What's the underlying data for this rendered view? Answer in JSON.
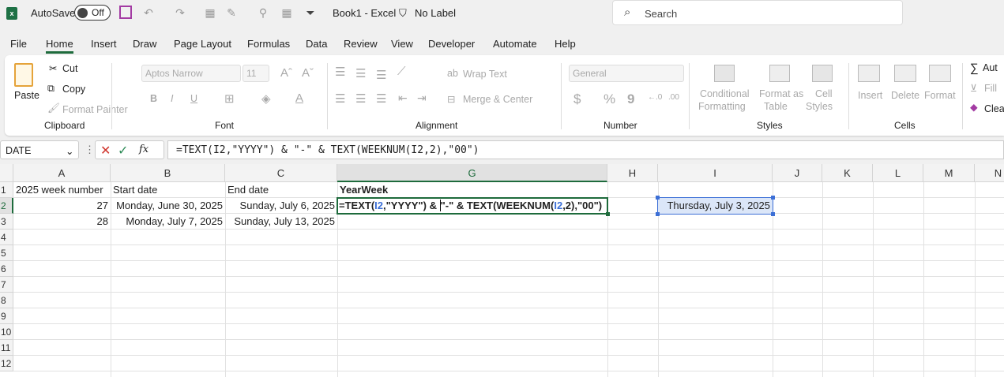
{
  "titlebar": {
    "autosave_label": "AutoSave",
    "autosave_state": "Off",
    "title": "Book1  -  Excel",
    "label": "No Label",
    "search_placeholder": "Search"
  },
  "menu": [
    "File",
    "Home",
    "Insert",
    "Draw",
    "Page Layout",
    "Formulas",
    "Data",
    "Review",
    "View",
    "Developer",
    "Automate",
    "Help"
  ],
  "ribbon": {
    "clipboard": {
      "paste": "Paste",
      "cut": "Cut",
      "copy": "Copy",
      "format_painter": "Format Painter",
      "group": "Clipboard"
    },
    "font": {
      "font_name": "Aptos Narrow",
      "font_size": "11",
      "bold": "B",
      "italic": "I",
      "underline": "U",
      "group": "Font"
    },
    "alignment": {
      "wrap_text": "Wrap Text",
      "merge_center": "Merge & Center",
      "group": "Alignment"
    },
    "number": {
      "format": "General",
      "currency": "$",
      "percent": "%",
      "comma": "9",
      "group": "Number"
    },
    "styles": {
      "conditional": [
        "Conditional",
        "Formatting"
      ],
      "format_table": [
        "Format as",
        "Table"
      ],
      "cell_styles": [
        "Cell",
        "Styles"
      ],
      "group": "Styles"
    },
    "cells": {
      "insert": "Insert",
      "delete": "Delete",
      "format": "Format",
      "group": "Cells"
    },
    "editing": {
      "autosum": "Aut",
      "fill": "Fill",
      "clear": "Clea"
    }
  },
  "formula_bar": {
    "name_box": "DATE",
    "fx": "fx",
    "formula": "=TEXT(I2,\"YYYY\") & \"-\" & TEXT(WEEKNUM(I2,2),\"00\")"
  },
  "grid": {
    "columns": [
      "A",
      "B",
      "C",
      "G",
      "H",
      "I",
      "J",
      "K",
      "L",
      "M",
      "N"
    ],
    "rows": [
      "1",
      "2",
      "3",
      "4",
      "5",
      "6",
      "7",
      "8",
      "9",
      "10",
      "11",
      "12"
    ],
    "cells": {
      "A1": "2025 week number",
      "B1": "Start date",
      "C1": "End date",
      "G1": "YearWeek",
      "A2": "27",
      "B2": "Monday, June 30, 2025",
      "C2": "Sunday, July 6, 2025",
      "A3": "28",
      "B3": "Monday, July 7, 2025",
      "C3": "Sunday, July 13, 2025",
      "I2": "Thursday, July 3, 2025"
    },
    "edit_parts": [
      "=TEXT(",
      "I2",
      ",\"YYYY\") & ",
      "\"-\" & TEXT(WEEKNUM(",
      "I2",
      ",2)",
      ",\"00\")"
    ]
  },
  "colors": {
    "accent": "#1e6b3c",
    "ref_blue": "#3c6fd6",
    "ref_red": "#c0392b"
  }
}
